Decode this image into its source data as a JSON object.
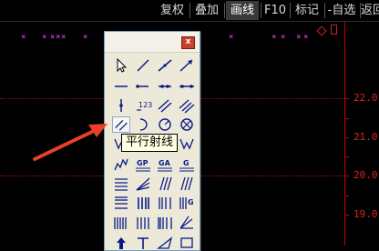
{
  "toolbar": {
    "items": [
      {
        "label": "复权",
        "active": false
      },
      {
        "label": "叠加",
        "active": false
      },
      {
        "label": "画线",
        "active": true
      },
      {
        "label": "F10",
        "active": false
      },
      {
        "label": "标记",
        "active": false
      },
      {
        "label": "-自选",
        "active": false
      },
      {
        "label": "返回",
        "active": false
      }
    ]
  },
  "chart": {
    "price_labels": [
      "22.0",
      "21.0",
      "20.0",
      "19.0"
    ],
    "marker_glyph": "×"
  },
  "palette": {
    "close_glyph": "x",
    "tools": [
      "cursor-arrow-icon",
      "line-segment-icon",
      "line-with-arrow-icon",
      "ray-arrow-icon",
      "horizontal-line-icon",
      "horizontal-segment-icon",
      "two-point-line-icon",
      "extended-line-icon",
      "vertical-line-icon",
      "price-label-icon",
      "parallel-lines-icon",
      "parallel-channel-icon",
      "parallel-ray-icon",
      "arc-icon",
      "circle-icon",
      "circle-cross-icon",
      "wave-icon",
      "fibonacci-fan-icon",
      "zigzag-icon",
      "w-pattern-icon",
      "curve-line-icon",
      "gp-tool-icon",
      "ga-tool-icon",
      "g-tool-icon",
      "fibonacci-lines-icon",
      "speed-lines-icon",
      "gann-lines-icon",
      "slanted-lines-icon",
      "fibonacci-levels-icon",
      "bar-group-icon",
      "vertical-bars-icon",
      "g-box-icon",
      "vertical-cycle-lines-icon",
      "cycle-lines-icon",
      "time-lines-icon",
      "angle-fan-icon",
      "up-arrow-icon",
      "text-tool-icon",
      "triangle-icon",
      "rectangle-icon"
    ],
    "labels": {
      "price_label": "123",
      "gp": "GP",
      "ga": "GA",
      "g": "G",
      "g2": "G"
    }
  },
  "tooltip": {
    "text": "平行射线"
  }
}
